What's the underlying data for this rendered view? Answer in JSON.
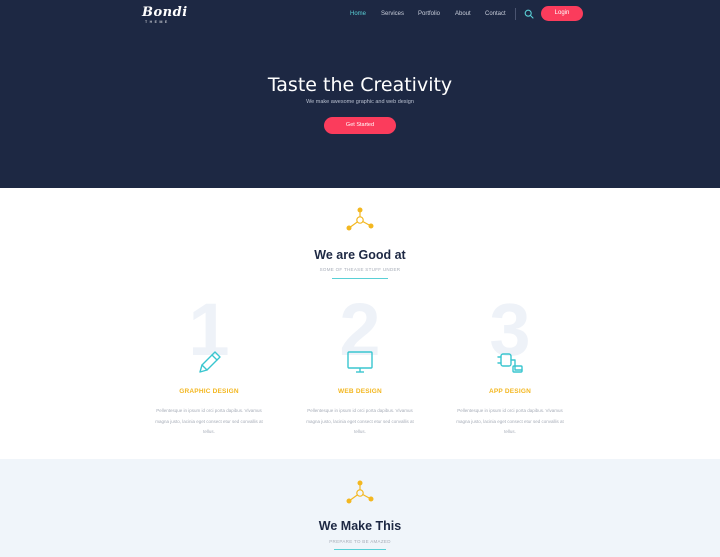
{
  "brand": {
    "name": "Bondi",
    "tagline": "THEME"
  },
  "nav": {
    "items": [
      {
        "label": "Home",
        "active": true
      },
      {
        "label": "Services",
        "active": false
      },
      {
        "label": "Portfolio",
        "active": false
      },
      {
        "label": "About",
        "active": false
      },
      {
        "label": "Contact",
        "active": false
      }
    ],
    "search_icon": "search-icon",
    "login_label": "Login"
  },
  "hero": {
    "title": "Taste the Creativity",
    "subtitle": "We make awesome graphic and web design",
    "cta_label": "Get Started"
  },
  "services": {
    "icon": "network-icon",
    "title": "We are Good at",
    "subtitle": "SOME OF THEASE STUFF UNDER",
    "items": [
      {
        "number": "1",
        "icon": "pencil-icon",
        "title": "GRAPHIC DESIGN",
        "desc": "Pellentesque in ipsum id orci porta dapibus. Vivamus magna justo, lacinia eget consect etur sed convallis at tellus."
      },
      {
        "number": "2",
        "icon": "monitor-icon",
        "title": "WEB DESIGN",
        "desc": "Pellentesque in ipsum id orci porta dapibus. Vivamus magna justo, lacinia eget consect etur sed convallis at tellus."
      },
      {
        "number": "3",
        "icon": "plug-icon",
        "title": "APP DESIGN",
        "desc": "Pellentesque in ipsum id orci porta dapibus. Vivamus magna justo, lacinia eget consect etur sed convallis at tellus."
      }
    ]
  },
  "work": {
    "icon": "network-icon",
    "title": "We Make This",
    "subtitle": "PREPARE TO BE AMAZED"
  },
  "colors": {
    "hero_bg": "#1d2843",
    "accent_teal": "#5ad0d6",
    "accent_red": "#fb3c5c",
    "accent_yellow": "#f3b720",
    "section_alt_bg": "#f0f5fa"
  }
}
